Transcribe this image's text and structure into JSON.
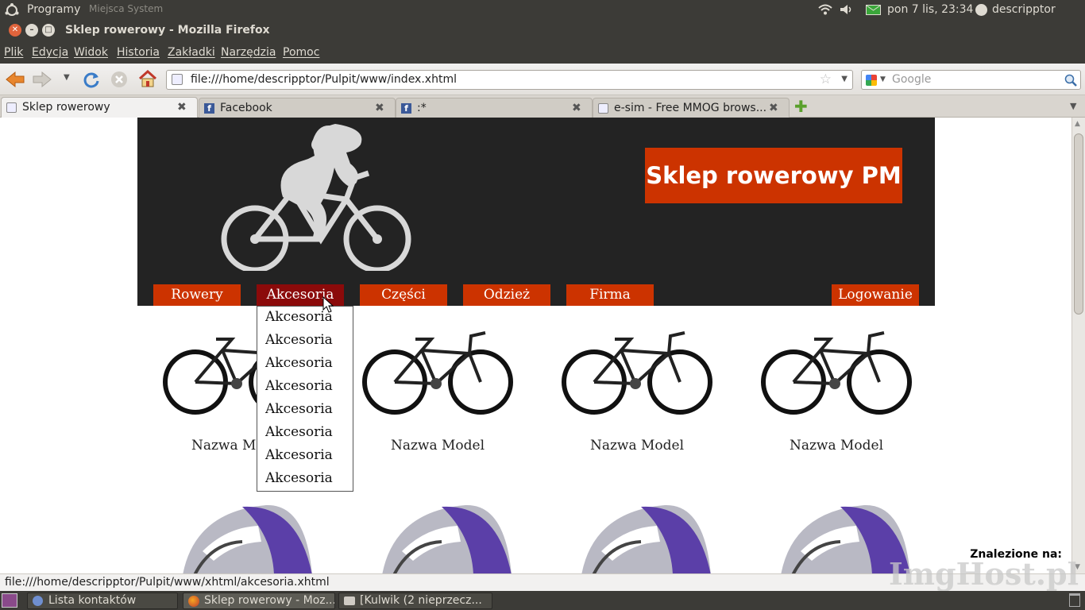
{
  "system": {
    "menu_label": "Programy",
    "menu_rest": "Miejsca   System",
    "clock": "pon 7 lis, 23:34",
    "user": "descripptor"
  },
  "window": {
    "title": "Sklep rowerowy - Mozilla Firefox"
  },
  "menubar": [
    "Plik",
    "Edycja",
    "Widok",
    "Historia",
    "Zakładki",
    "Narzędzia",
    "Pomoc"
  ],
  "toolbar": {
    "url": "file:///home/descripptor/Pulpit/www/index.xhtml",
    "search_placeholder": "Google"
  },
  "tabs": [
    {
      "label": "Sklep rowerowy"
    },
    {
      "label": "Facebook"
    },
    {
      "label": ":*"
    },
    {
      "label": "e-sim - Free MMOG brows..."
    }
  ],
  "page": {
    "brand": "Sklep rowerowy PM",
    "nav": [
      "Rowery",
      "Akcesoria",
      "Części",
      "Odzież",
      "Firma"
    ],
    "login": "Logowanie",
    "dropdown": [
      "Akcesoria",
      "Akcesoria",
      "Akcesoria",
      "Akcesoria",
      "Akcesoria",
      "Akcesoria",
      "Akcesoria",
      "Akcesoria"
    ],
    "product_name": "Nazwa Model",
    "found_on": "Znalezione na:"
  },
  "statusbar": {
    "text": "file:///home/descripptor/Pulpit/www/xhtml/akcesoria.xhtml"
  },
  "taskbar": [
    {
      "label": "Lista kontaktów"
    },
    {
      "label": "Sklep rowerowy - Moz..."
    },
    {
      "label": "[Kulwik (2 nieprzecz..."
    }
  ],
  "watermark": "ImgHost.pl",
  "colors": {
    "brand": "#cc3300",
    "nav_active": "#8b0a0a",
    "header_bg": "#232323"
  }
}
